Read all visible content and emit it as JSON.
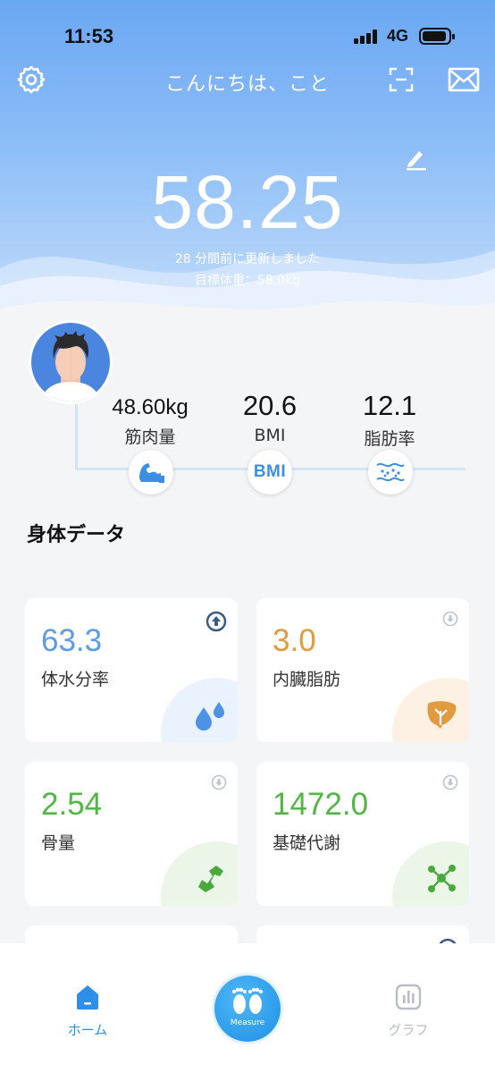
{
  "status_bar": {
    "time": "11:53",
    "network": "4G"
  },
  "header": {
    "greeting": "こんにちは、こと",
    "weight": "58.25",
    "updated": "28 分間前に更新しました",
    "target": "目標体重：58.0kg"
  },
  "metrics": [
    {
      "value": "48.60kg",
      "label": "筋肉量",
      "icon": "muscle-icon"
    },
    {
      "value": "20.6",
      "label": "BMI",
      "icon": "bmi-icon"
    },
    {
      "value": "12.1",
      "label": "脂肪率",
      "icon": "fat-rate-icon"
    }
  ],
  "bmi_icon_text": "BMI",
  "section_title": "身体データ",
  "cards": [
    {
      "value": "63.3",
      "label": "体水分率",
      "color": "#5b9be8",
      "icon": "water-drops-icon",
      "trend": "up"
    },
    {
      "value": "3.0",
      "label": "内臓脂肪",
      "color": "#e29a3e",
      "icon": "liver-icon",
      "trend": "down"
    },
    {
      "value": "2.54",
      "label": "骨量",
      "color": "#52b545",
      "icon": "bone-icon",
      "trend": "down"
    },
    {
      "value": "1472.0",
      "label": "基礎代謝",
      "color": "#52b545",
      "icon": "molecule-icon",
      "trend": "down"
    }
  ],
  "nav": {
    "home": "ホーム",
    "measure": "Measure",
    "graph": "グラフ"
  },
  "colors": {
    "accent": "#1e8fe6",
    "header": "#6aa7f3"
  }
}
